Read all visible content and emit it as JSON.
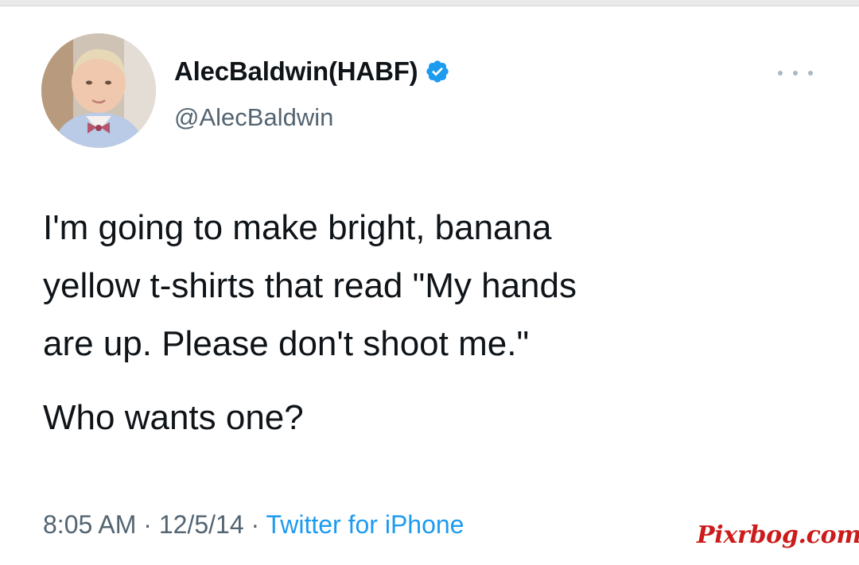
{
  "tweet": {
    "author": {
      "display_name": "AlecBaldwin(HABF)",
      "handle": "@AlecBaldwin",
      "verified": true,
      "avatar_icon": "avatar-photo"
    },
    "menu_icon": "more-options-icon",
    "text": {
      "line1": "I'm going to make bright, banana",
      "line2": "yellow t-shirts that read \"My hands",
      "line3": "are up. Please don't shoot me.\"",
      "paragraph2": "Who wants one?"
    },
    "meta": {
      "time": "8:05 AM",
      "separator": "·",
      "date": "12/5/14",
      "source": "Twitter for iPhone"
    }
  },
  "watermark": "Pixrbog.com",
  "colors": {
    "text": "#0f1419",
    "secondary": "#536471",
    "link": "#1d9bf0",
    "verified": "#1d9bf0",
    "watermark": "#cc1b1b"
  }
}
